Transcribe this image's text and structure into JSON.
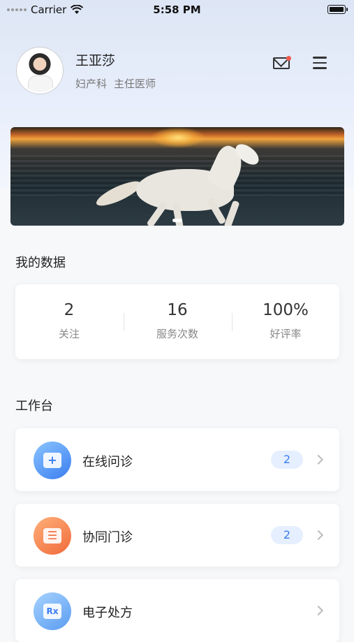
{
  "status_bar": {
    "carrier": "Carrier",
    "time": "5:58 PM"
  },
  "profile": {
    "name": "王亚莎",
    "department": "妇产科",
    "title": "主任医师"
  },
  "sections": {
    "my_data": "我的数据",
    "workbench": "工作台"
  },
  "stats": [
    {
      "value": "2",
      "label": "关注"
    },
    {
      "value": "16",
      "label": "服务次数"
    },
    {
      "value": "100%",
      "label": "好评率"
    }
  ],
  "work_items": [
    {
      "label": "在线问诊",
      "badge": "2",
      "icon": "online-consultation-icon",
      "color": "#3a7df0"
    },
    {
      "label": "协同门诊",
      "badge": "2",
      "icon": "clinic-monitor-icon",
      "color": "#f06a3a"
    },
    {
      "label": "电子处方",
      "badge": "",
      "icon": "prescription-rx-icon",
      "color": "#5a9cf0"
    }
  ],
  "icons": {
    "rx_text": "Rx"
  },
  "colors": {
    "accent": "#3a7df0",
    "notification_dot": "#f25a4f",
    "header_bg": "#dde6f5"
  }
}
